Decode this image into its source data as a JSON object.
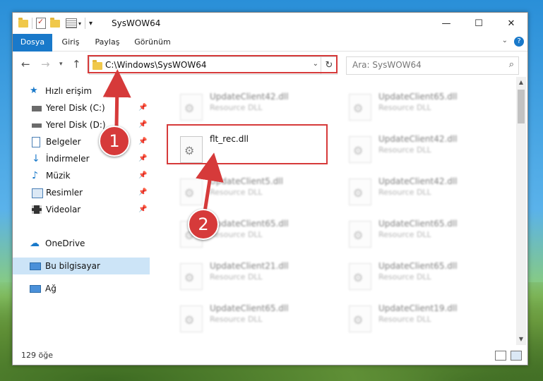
{
  "window": {
    "title": "SysWOW64"
  },
  "ribbon": {
    "tabs": [
      "Dosya",
      "Giriş",
      "Paylaş",
      "Görünüm"
    ]
  },
  "address": {
    "path": "C:\\Windows\\SysWOW64"
  },
  "search": {
    "placeholder": "Ara: SysWOW64"
  },
  "nav": {
    "quick_access": "Hızlı erişim",
    "items": [
      "Yerel Disk (C:)",
      "Yerel Disk (D:)",
      "Belgeler",
      "İndirmeler",
      "Müzik",
      "Resimler",
      "Videolar"
    ],
    "onedrive": "OneDrive",
    "this_pc": "Bu bilgisayar",
    "network": "Ağ"
  },
  "files": [
    {
      "name": "UpdateClient42.dll",
      "type": "Resource DLL",
      "blurred": true
    },
    {
      "name": "UpdateClient65.dll",
      "type": "Resource DLL",
      "blurred": true
    },
    {
      "name": "flt_rec.dll",
      "type": "",
      "blurred": false
    },
    {
      "name": "UpdateClient42.dll",
      "type": "Resource DLL",
      "blurred": true
    },
    {
      "name": "UpdateClient5.dll",
      "type": "Resource DLL",
      "blurred": true
    },
    {
      "name": "UpdateClient42.dll",
      "type": "Resource DLL",
      "blurred": true
    },
    {
      "name": "UpdateClient65.dll",
      "type": "Resource DLL",
      "blurred": true
    },
    {
      "name": "UpdateClient65.dll",
      "type": "Resource DLL",
      "blurred": true
    },
    {
      "name": "UpdateClient21.dll",
      "type": "Resource DLL",
      "blurred": true
    },
    {
      "name": "UpdateClient65.dll",
      "type": "Resource DLL",
      "blurred": true
    },
    {
      "name": "UpdateClient65.dll",
      "type": "Resource DLL",
      "blurred": true
    },
    {
      "name": "UpdateClient19.dll",
      "type": "Resource DLL",
      "blurred": true
    }
  ],
  "status": {
    "item_count": "129 öğe"
  },
  "callouts": {
    "one": "1",
    "two": "2"
  },
  "colors": {
    "accent": "#1979ca",
    "highlight": "#d63a3a",
    "selection": "#cce4f7"
  }
}
